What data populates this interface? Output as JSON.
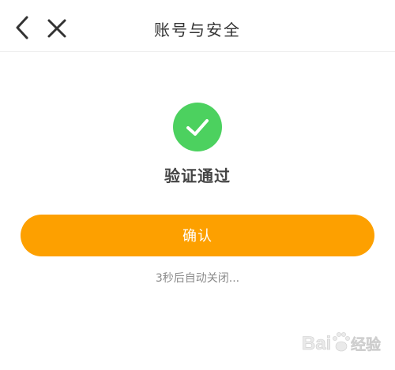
{
  "header": {
    "title": "账号与安全",
    "back_icon": "chevron-left-icon",
    "close_icon": "close-icon"
  },
  "status": {
    "icon": "check-circle-icon",
    "icon_color": "#4cd15f",
    "text": "验证通过"
  },
  "confirm_button": {
    "label": "确认",
    "color": "#fda000"
  },
  "countdown_text": "3秒后自动关闭...",
  "watermark": {
    "icon": "baidu-jingyan-logo",
    "text": "Bai 经验"
  }
}
